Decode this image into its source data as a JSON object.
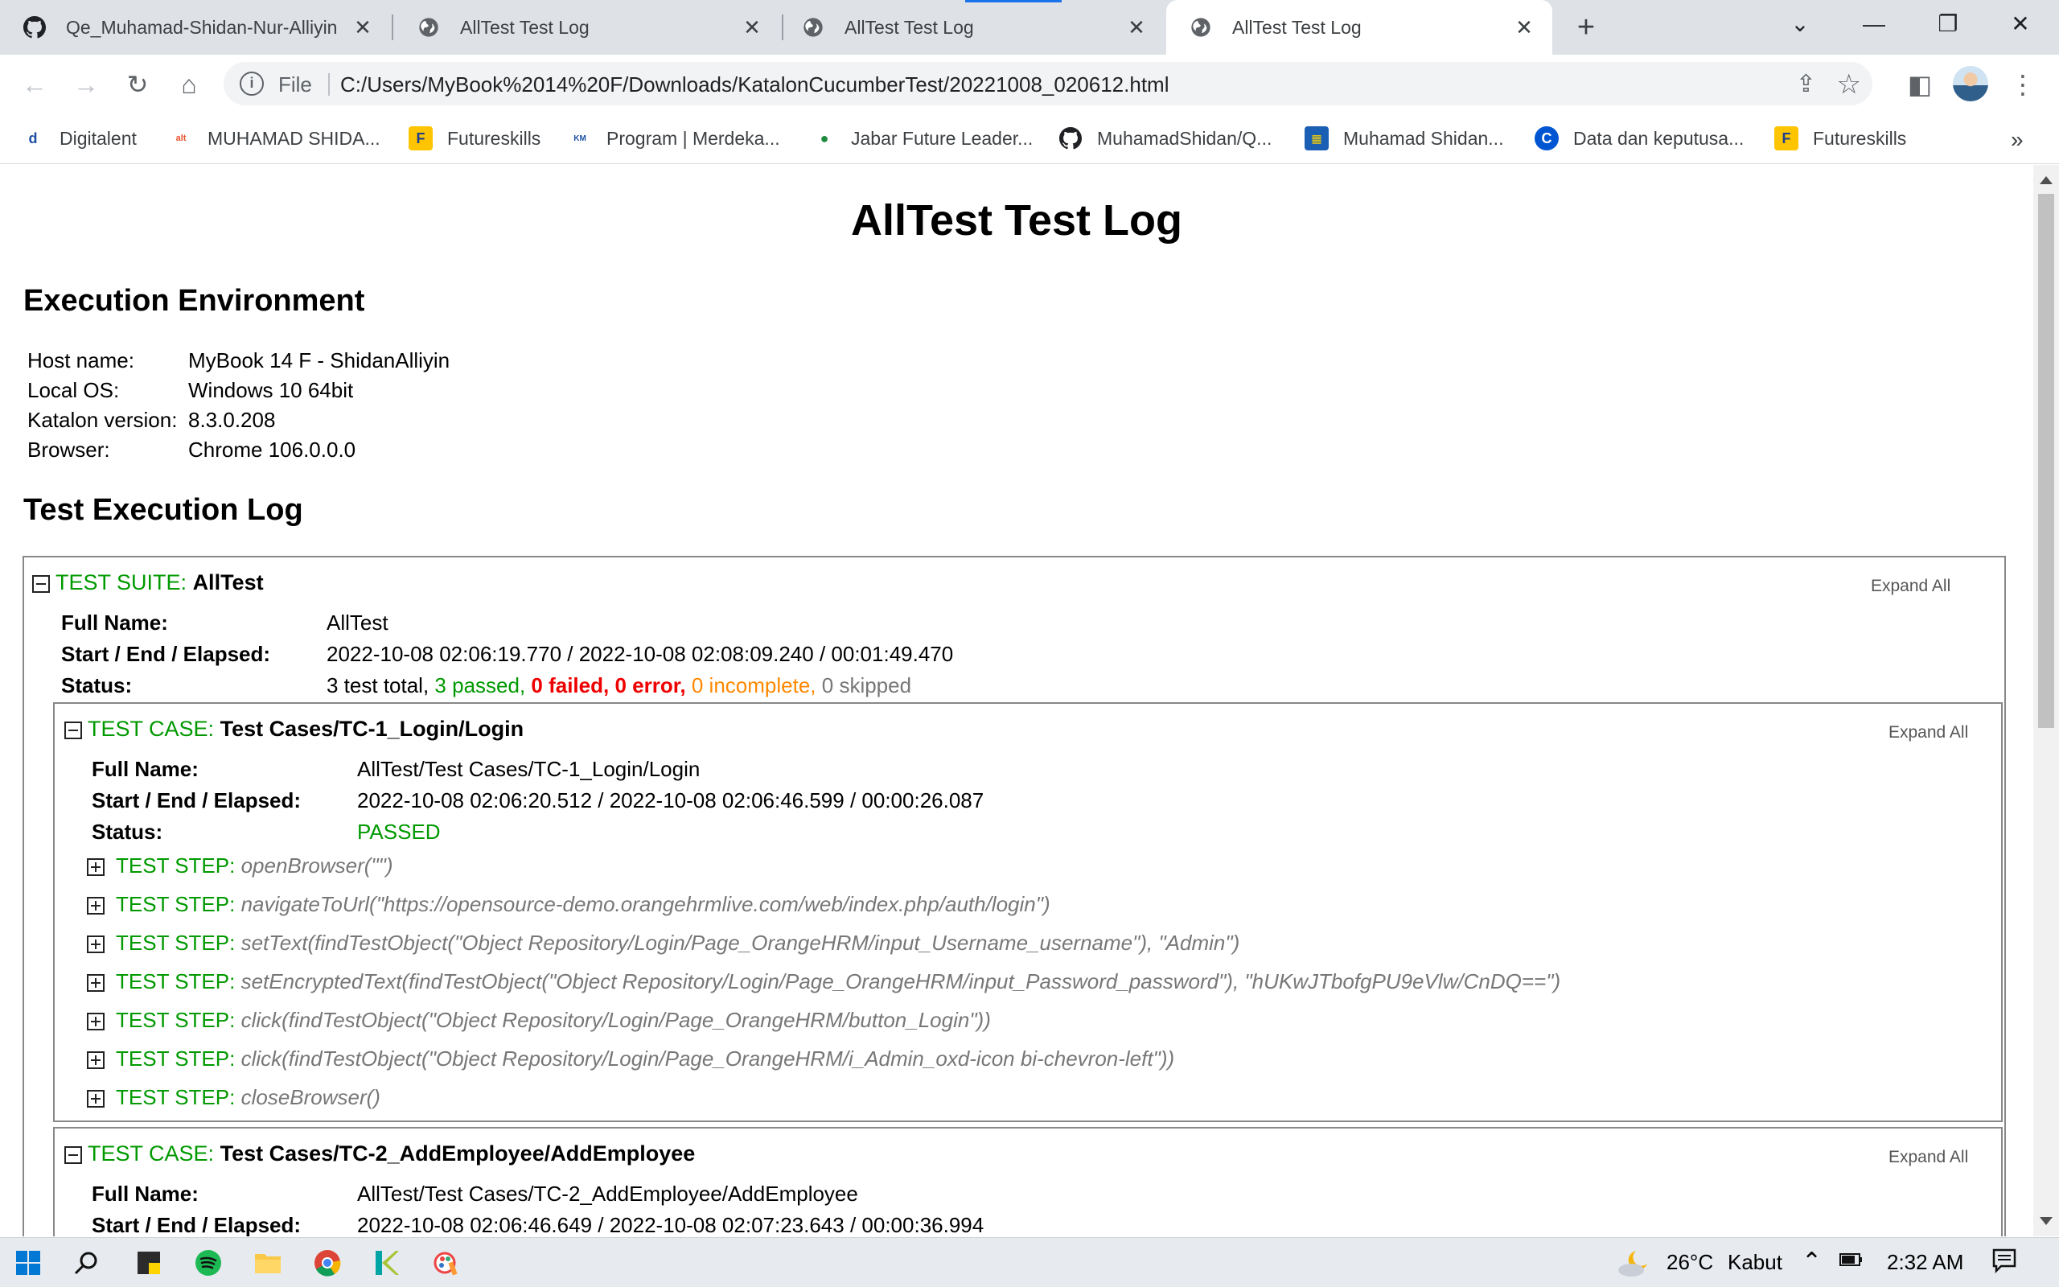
{
  "browser": {
    "tabs": [
      {
        "title": "Qe_Muhamad-Shidan-Nur-Alliyin",
        "icon": "github-icon",
        "active": false
      },
      {
        "title": "AllTest Test Log",
        "icon": "globe-icon",
        "active": false
      },
      {
        "title": "AllTest Test Log",
        "icon": "globe-icon",
        "active": false
      },
      {
        "title": "AllTest Test Log",
        "icon": "globe-icon",
        "active": true
      }
    ],
    "scheme_label": "File",
    "url": "C:/Users/MyBook%2014%20F/Downloads/KatalonCucumberTest/20221008_020612.html",
    "bookmarks": [
      {
        "label": "Digitalent",
        "icon": "digitalent-icon"
      },
      {
        "label": "MUHAMAD SHIDA...",
        "icon": "alterra-icon"
      },
      {
        "label": "Futureskills",
        "icon": "futureskills-icon"
      },
      {
        "label": "Program | Merdeka...",
        "icon": "kampus-merdeka-icon"
      },
      {
        "label": "Jabar Future Leader...",
        "icon": "jabar-icon"
      },
      {
        "label": "MuhamadShidan/Q...",
        "icon": "github-icon"
      },
      {
        "label": "Muhamad Shidan...",
        "icon": "app-icon"
      },
      {
        "label": "Data dan keputusa...",
        "icon": "coursera-icon"
      },
      {
        "label": "Futureskills",
        "icon": "futureskills-icon"
      }
    ],
    "more_bookmarks": "»"
  },
  "page": {
    "title": "AllTest Test Log",
    "env_heading": "Execution Environment",
    "environment": [
      {
        "key": "Host name:",
        "value": "MyBook 14 F - ShidanAlliyin"
      },
      {
        "key": "Local OS:",
        "value": "Windows 10 64bit"
      },
      {
        "key": "Katalon version:",
        "value": "8.3.0.208"
      },
      {
        "key": "Browser:",
        "value": "Chrome 106.0.0.0"
      }
    ],
    "log_heading": "Test Execution Log",
    "suite": {
      "label": "TEST SUITE:",
      "name": "AllTest",
      "expand_all": "Expand All",
      "full_name_key": "Full Name:",
      "full_name": "AllTest",
      "times_key": "Start / End / Elapsed:",
      "times": "2022-10-08 02:06:19.770 / 2022-10-08 02:08:09.240 / 00:01:49.470",
      "status_key": "Status:",
      "status_total": "3 test total,",
      "status_passed": "3 passed,",
      "status_failed": "0 failed,",
      "status_error": "0 error,",
      "status_incomplete": "0 incomplete,",
      "status_skipped": "0 skipped"
    },
    "case1": {
      "label": "TEST CASE:",
      "name": "Test Cases/TC-1_Login/Login",
      "expand_all": "Expand All",
      "full_name_key": "Full Name:",
      "full_name": "AllTest/Test Cases/TC-1_Login/Login",
      "times_key": "Start / End / Elapsed:",
      "times": "2022-10-08 02:06:20.512 / 2022-10-08 02:06:46.599 / 00:00:26.087",
      "status_key": "Status:",
      "status": "PASSED",
      "step_label": "TEST STEP:",
      "steps": [
        "openBrowser(\"\")",
        "navigateToUrl(\"https://opensource-demo.orangehrmlive.com/web/index.php/auth/login\")",
        "setText(findTestObject(\"Object Repository/Login/Page_OrangeHRM/input_Username_username\"), \"Admin\")",
        "setEncryptedText(findTestObject(\"Object Repository/Login/Page_OrangeHRM/input_Password_password\"), \"hUKwJTbofgPU9eVlw/CnDQ==\")",
        "click(findTestObject(\"Object Repository/Login/Page_OrangeHRM/button_Login\"))",
        "click(findTestObject(\"Object Repository/Login/Page_OrangeHRM/i_Admin_oxd-icon bi-chevron-left\"))",
        "closeBrowser()"
      ]
    },
    "case2": {
      "label": "TEST CASE:",
      "name": "Test Cases/TC-2_AddEmployee/AddEmployee",
      "expand_all": "Expand All",
      "full_name_key": "Full Name:",
      "full_name": "AllTest/Test Cases/TC-2_AddEmployee/AddEmployee",
      "times_key": "Start / End / Elapsed:",
      "times": "2022-10-08 02:06:46.649 / 2022-10-08 02:07:23.643 / 00:00:36.994"
    }
  },
  "taskbar": {
    "apps": [
      "windows-start-icon",
      "search-icon",
      "notes-icon",
      "spotify-icon",
      "file-explorer-icon",
      "chrome-icon",
      "katalon-icon",
      "paint-icon"
    ],
    "weather_temp": "26°C",
    "weather_text": "Kabut",
    "clock": "2:32 AM"
  },
  "colors": {
    "pass_green": "#009900",
    "fail_red": "#ee0000",
    "incomplete_orange": "#ff8800",
    "tab_strip": "#dee1e6"
  }
}
